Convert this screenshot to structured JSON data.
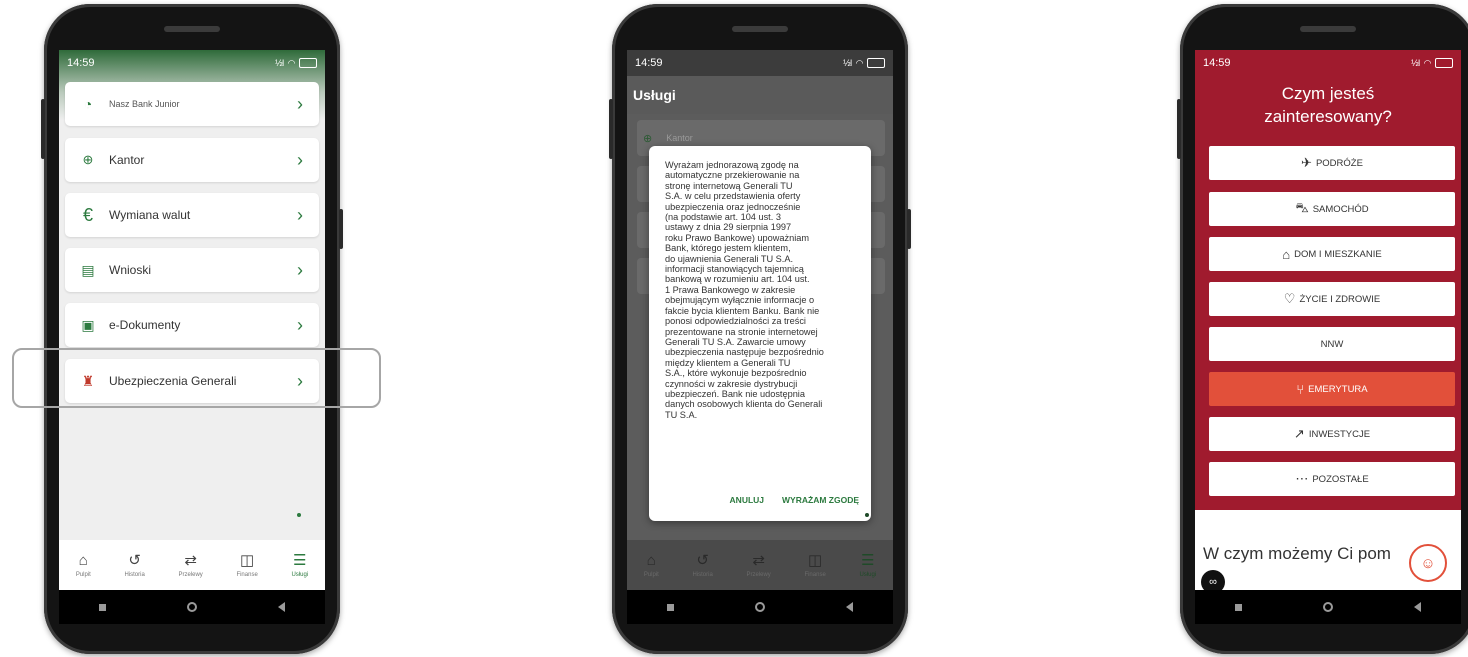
{
  "status_time": "14:59",
  "status_signal": "½l",
  "phone1": {
    "items": [
      {
        "label": "Nasz Bank Junior",
        "icon": "piggy-bank-icon"
      },
      {
        "label": "Kantor",
        "icon": "currency-exchange-icon"
      },
      {
        "label": "Wymiana walut",
        "icon": "euro-icon"
      },
      {
        "label": "Wnioski",
        "icon": "document-icon"
      },
      {
        "label": "e-Dokumenty",
        "icon": "e-document-icon"
      },
      {
        "label": "Ubezpieczenia Generali",
        "icon": "generali-logo-icon"
      }
    ],
    "tabs": [
      {
        "label": "Pulpit",
        "icon": "home-icon"
      },
      {
        "label": "Historia",
        "icon": "history-icon"
      },
      {
        "label": "Przelewy",
        "icon": "transfer-icon"
      },
      {
        "label": "Finanse",
        "icon": "wallet-icon"
      },
      {
        "label": "Usługi",
        "icon": "services-icon"
      }
    ],
    "active_tab": "Usługi"
  },
  "phone2": {
    "header": "Usługi",
    "bg_item": "Kantor",
    "dialog_text": "Wyrażam jednorazową zgodę na\nautomatyczne przekierowanie na\nstronę internetową Generali TU\nS.A. w celu przedstawienia oferty\nubezpieczenia oraz jednocześnie\n(na podstawie art. 104 ust. 3\nustawy z dnia 29 sierpnia 1997\nroku Prawo Bankowe) upoważniam\nBank, którego jestem klientem,\ndo ujawnienia Generali TU S.A.\ninformacji stanowiących tajemnicą\nbankową w rozumieniu art. 104 ust.\n1 Prawa Bankowego w zakresie\nobejmującym wyłącznie informacje o\nfakcie bycia klientem Banku. Bank nie\nponosi odpowiedzialności za treści\nprezentowane na stronie internetowej\nGenerali TU S.A. Zawarcie umowy\nubezpieczenia następuje bezpośrednio\nmiędzy klientem a Generali TU\nS.A., które wykonuje bezpośrednio\nczynności w zakresie dystrybucji\nubezpieczeń. Bank nie udostępnia\ndanych osobowych klienta do Generali\nTU S.A.",
    "cancel": "ANULUJ",
    "agree": "WYRAŻAM ZGODĘ",
    "tabs": [
      "Pulpit",
      "Historia",
      "Przelewy",
      "Finanse",
      "Usługi"
    ]
  },
  "phone3": {
    "title_line1": "Czym jesteś",
    "title_line2": "zainteresowany?",
    "options": [
      {
        "label": "PODRÓŻE",
        "icon": "plane-icon"
      },
      {
        "label": "SAMOCHÓD",
        "icon": "car-icon"
      },
      {
        "label": "DOM I MIESZKANIE",
        "icon": "house-icon"
      },
      {
        "label": "ŻYCIE I ZDROWIE",
        "icon": "heart-icon"
      },
      {
        "label": "NNW",
        "icon": ""
      },
      {
        "label": "EMERYTURA",
        "icon": "rocking-chair-icon"
      },
      {
        "label": "INWESTYCJE",
        "icon": "growth-icon"
      },
      {
        "label": "POZOSTAŁE",
        "icon": "more-icon"
      }
    ],
    "active_option": "EMERYTURA",
    "help_text": "W czym możemy Ci pom"
  },
  "colors": {
    "accent_green": "#2c7a3f",
    "generali_red": "#a01b2e",
    "active_orange": "#e2503a"
  }
}
